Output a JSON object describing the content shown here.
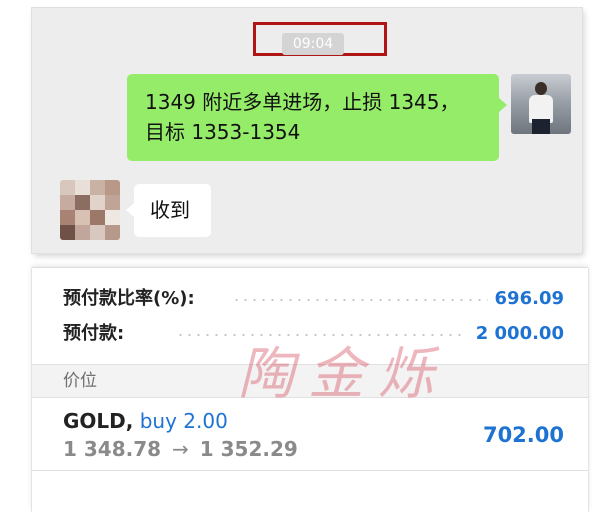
{
  "chat": {
    "timestamp": "09:04",
    "sent_message": {
      "line1": "1349 附近多单进场，止损 1345，",
      "line2": "目标 1353-1354"
    },
    "received_message": "收到",
    "avatars": {
      "self": "user-photo-avatar",
      "other": "blurred-avatar"
    },
    "colors": {
      "sent_bubble": "#95ec69",
      "highlight_box": "#b01515"
    }
  },
  "account": {
    "margin_level_label": "预付款比率(%):",
    "margin_level_value": "696.09",
    "margin_label": "预付款:",
    "margin_value": "2 000.00"
  },
  "positions": {
    "section_title": "价位",
    "items": [
      {
        "symbol": "GOLD,",
        "direction": "buy 2.00",
        "open_price": "1 348.78",
        "arrow": "→",
        "current_price": "1 352.29",
        "profit": "702.00"
      }
    ]
  },
  "watermark": "陶金烁",
  "accent_color": "#1e73d2"
}
